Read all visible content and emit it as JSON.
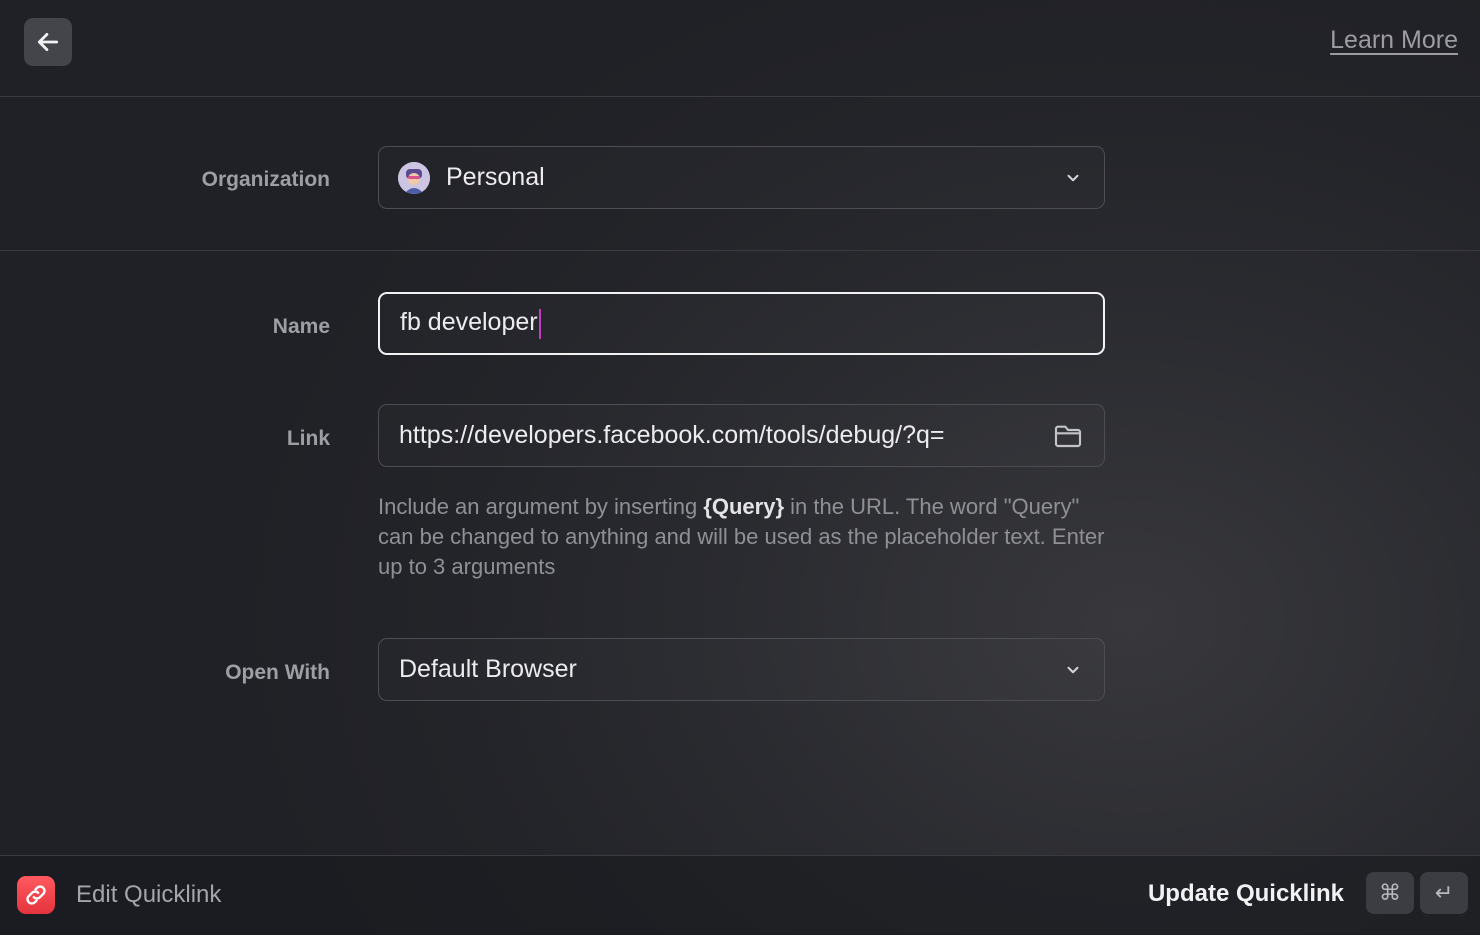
{
  "header": {
    "back_icon": "arrow-left-icon",
    "learn_more": "Learn More"
  },
  "form": {
    "organization": {
      "label": "Organization",
      "value": "Personal",
      "avatar_icon": "user-avatar-icon",
      "dropdown_icon": "chevron-down-icon"
    },
    "name": {
      "label": "Name",
      "value": "fb developer"
    },
    "link": {
      "label": "Link",
      "value": "https://developers.facebook.com/tools/debug/?q=",
      "browse_icon": "folder-icon",
      "help_part1": "Include an argument by inserting ",
      "help_token": "{Query}",
      "help_part2": " in the URL. The word \"Query\" can be changed to anything and will be used as the placeholder text. Enter up to 3 arguments"
    },
    "open_with": {
      "label": "Open With",
      "value": "Default Browser",
      "dropdown_icon": "chevron-down-icon"
    }
  },
  "footer": {
    "app_icon": "link-icon",
    "title": "Edit Quicklink",
    "primary_action": "Update Quicklink",
    "shortcut_keys": [
      "⌘",
      "↵"
    ]
  },
  "colors": {
    "background": "#25262b",
    "accent": "#ff5a5f",
    "caret": "#c03cc0"
  }
}
